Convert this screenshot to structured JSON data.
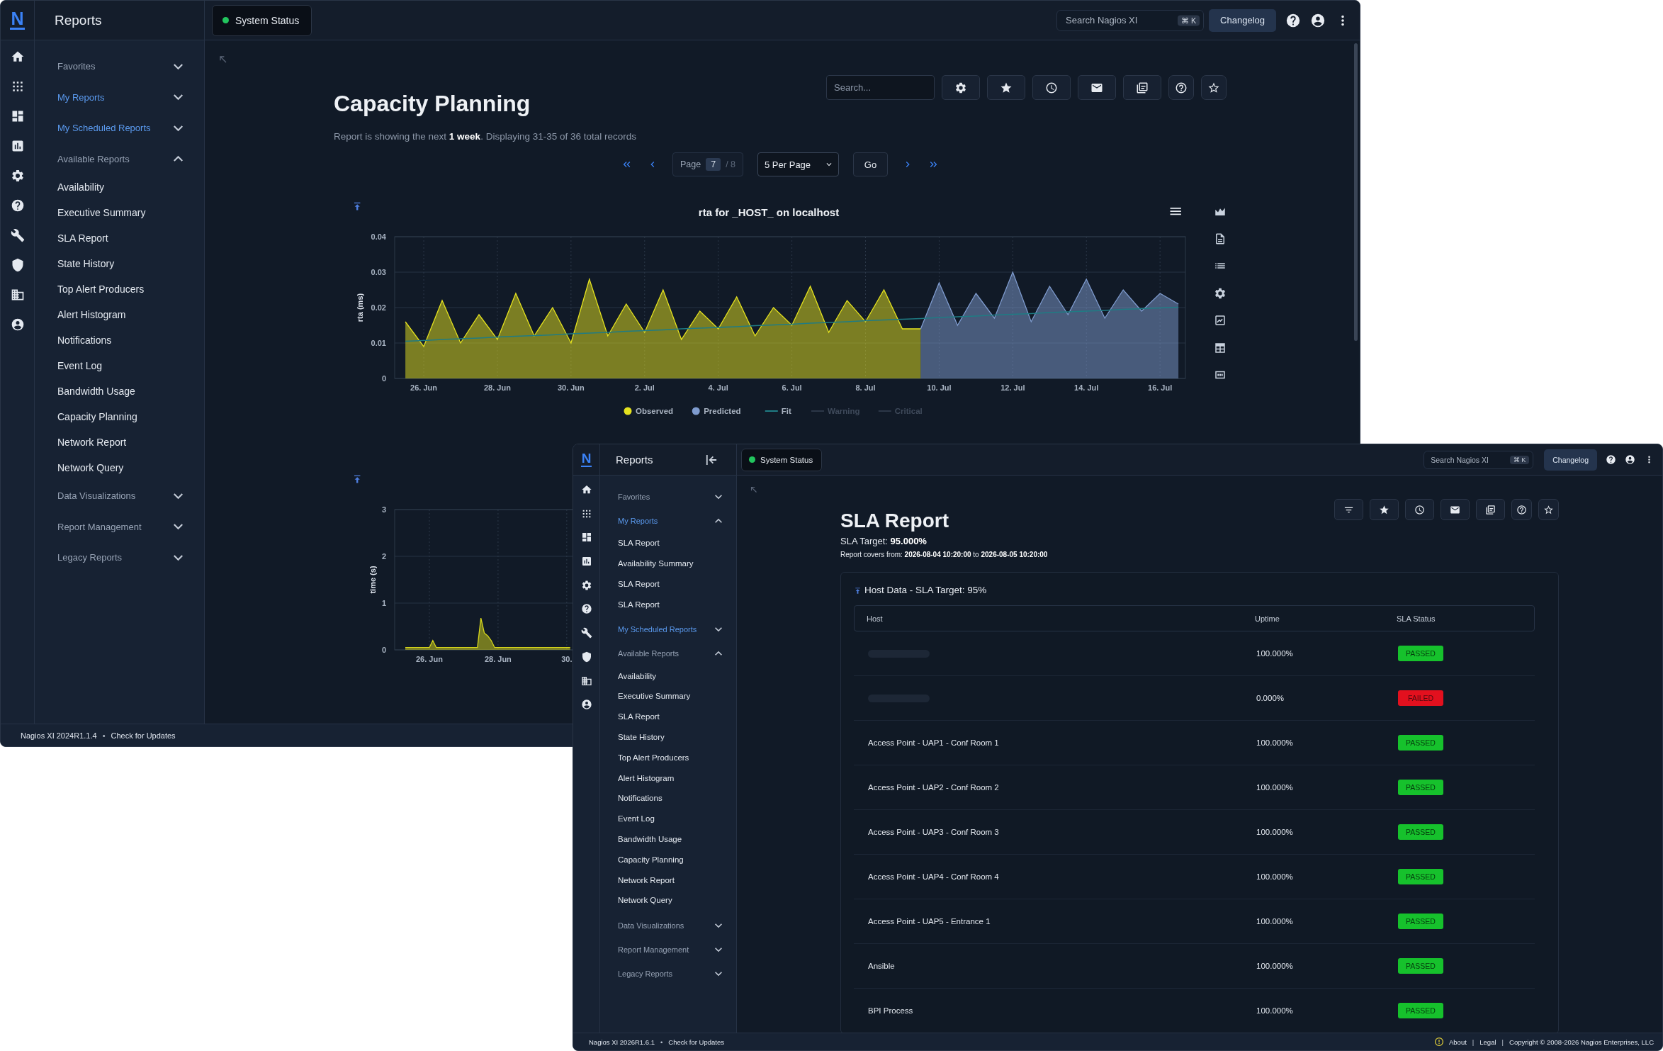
{
  "windows": [
    {
      "kind": "back",
      "header": {
        "logo": "N",
        "title": "Reports",
        "status": {
          "label": "System Status",
          "ok": true
        },
        "search": {
          "placeholder": "Search Nagios XI",
          "shortcut": "⌘ K"
        },
        "changelog": "Changelog"
      },
      "sidebar": {
        "groups": [
          {
            "label": "Favorites",
            "highlighted": false,
            "expanded": false
          },
          {
            "label": "My Reports",
            "highlighted": true,
            "expanded": false
          },
          {
            "label": "My Scheduled Reports",
            "highlighted": true,
            "expanded": false
          },
          {
            "label": "Available Reports",
            "highlighted": false,
            "expanded": true,
            "children": [
              {
                "label": "Availability"
              },
              {
                "label": "Executive Summary"
              },
              {
                "label": "SLA Report"
              },
              {
                "label": "State History"
              },
              {
                "label": "Top Alert Producers"
              },
              {
                "label": "Alert Histogram"
              },
              {
                "label": "Notifications"
              },
              {
                "label": "Event Log"
              },
              {
                "label": "Bandwidth Usage"
              },
              {
                "label": "Capacity Planning"
              },
              {
                "label": "Network Report"
              },
              {
                "label": "Network Query"
              }
            ]
          },
          {
            "label": "Data Visualizations",
            "highlighted": false,
            "expanded": false
          },
          {
            "label": "Report Management",
            "highlighted": false,
            "expanded": false
          },
          {
            "label": "Legacy Reports",
            "highlighted": false,
            "expanded": false
          }
        ]
      },
      "page": {
        "kind": "capacity_planning",
        "title": "Capacity Planning",
        "search": {
          "placeholder": "Search..."
        },
        "summary": "Report is showing the next **1 week**. Displaying 31-35 of 36 total records",
        "pagination": {
          "page_label": "Page",
          "page": "7",
          "page_count": "/ 8",
          "per_page": "5 Per Page",
          "go": "Go"
        },
        "charts": [
          {
            "chart_data": {
              "type": "area",
              "title": "rta for _HOST_ on localhost",
              "ylabel": "rta (ms)",
              "grid": true,
              "legend": "bottom",
              "categories": [
                null,
                "26. Jun",
                null,
                null,
                null,
                "28. Jun",
                null,
                null,
                null,
                "30. Jun",
                null,
                null,
                null,
                "2. Jul",
                null,
                null,
                null,
                "4. Jul",
                null,
                null,
                null,
                "6. Jul",
                null,
                null,
                null,
                "8. Jul",
                null,
                null,
                null,
                "10. Jul",
                null,
                null,
                null,
                "12. Jul",
                null,
                null,
                null,
                "14. Jul",
                null,
                null,
                null,
                "16. Jul",
                null
              ],
              "ylim": [
                0,
                0.04
              ],
              "yticks": [
                0,
                0.01,
                0.02,
                0.03,
                0.04
              ],
              "series": [
                {
                  "name": "Observed",
                  "color": "#e5e21f",
                  "values": [
                    0.016,
                    0.009,
                    0.022,
                    0.01,
                    0.018,
                    0.011,
                    0.024,
                    0.012,
                    0.02,
                    0.01,
                    0.028,
                    0.012,
                    0.021,
                    0.013,
                    0.025,
                    0.011,
                    0.019,
                    0.014,
                    0.023,
                    0.012,
                    0.02,
                    0.015,
                    0.026,
                    0.013,
                    0.022,
                    0.016,
                    0.025,
                    0.014,
                    0.014,
                    null,
                    null,
                    null,
                    null,
                    null,
                    null,
                    null,
                    null,
                    null,
                    null,
                    null,
                    null,
                    null,
                    null
                  ]
                },
                {
                  "name": "Predicted",
                  "color": "#7f9ccf",
                  "values": [
                    null,
                    null,
                    null,
                    null,
                    null,
                    null,
                    null,
                    null,
                    null,
                    null,
                    null,
                    null,
                    null,
                    null,
                    null,
                    null,
                    null,
                    null,
                    null,
                    null,
                    null,
                    null,
                    null,
                    null,
                    null,
                    null,
                    null,
                    null,
                    0.014,
                    0.027,
                    0.015,
                    0.024,
                    0.017,
                    0.03,
                    0.016,
                    0.026,
                    0.018,
                    0.028,
                    0.017,
                    0.025,
                    0.019,
                    0.024,
                    0.021
                  ]
                },
                {
                  "name": "Fit",
                  "color": "#1f7c84",
                  "type": "line",
                  "values": [
                    0.0105,
                    0.0107,
                    0.011,
                    0.0112,
                    0.0114,
                    0.0117,
                    0.0119,
                    0.0121,
                    0.0123,
                    0.0126,
                    0.0128,
                    0.013,
                    0.0133,
                    0.0135,
                    0.0137,
                    0.014,
                    0.0142,
                    0.0144,
                    0.0146,
                    0.0149,
                    0.0151,
                    0.0153,
                    0.0156,
                    0.0158,
                    0.016,
                    0.0163,
                    0.0165,
                    0.0167,
                    0.0169,
                    0.0172,
                    0.0174,
                    0.0176,
                    0.0179,
                    0.0181,
                    0.0183,
                    0.0186,
                    0.0188,
                    0.019,
                    0.0192,
                    0.0195,
                    0.0197,
                    0.0199,
                    0.0201
                  ]
                }
              ]
            },
            "hidden_legend_items": [
              {
                "label": "Warning"
              },
              {
                "label": "Critical"
              }
            ]
          },
          {
            "chart_data": {
              "type": "area",
              "ylabel": "time (s)",
              "grid": true,
              "categories": [
                null,
                null,
                null,
                null,
                null,
                null,
                null,
                "26. Jun",
                null,
                null,
                null,
                null,
                null,
                null,
                null,
                null,
                null,
                null,
                null,
                null,
                null,
                null,
                null,
                null,
                null,
                null,
                null,
                "28. Jun",
                null,
                null,
                null,
                null,
                null,
                null,
                null,
                null,
                null,
                null,
                null,
                null,
                null,
                null,
                null,
                null,
                null,
                null,
                null,
                "30.",
                null,
                null
              ],
              "ylim": [
                0,
                3
              ],
              "yticks": [
                0,
                1,
                2,
                3
              ],
              "series": [
                {
                  "color": "#d8d81c",
                  "values": [
                    0.05,
                    0.05,
                    0.05,
                    0.05,
                    0.05,
                    0.05,
                    0.05,
                    0.05,
                    0.2,
                    0.05,
                    0.05,
                    0.05,
                    0.05,
                    0.05,
                    0.05,
                    0.05,
                    0.05,
                    0.05,
                    0.05,
                    0.05,
                    0.05,
                    0.05,
                    0.68,
                    0.36,
                    0.3,
                    0.2,
                    0.05,
                    0.05,
                    0.05,
                    0.05,
                    0.05,
                    0.05,
                    0.05,
                    0.05,
                    0.05,
                    0.05,
                    0.05,
                    0.05,
                    0.05,
                    0.05,
                    0.05,
                    0.05,
                    0.05,
                    0.05,
                    0.05,
                    0.05,
                    0.05,
                    0.05,
                    0.05,
                    null
                  ]
                }
              ]
            }
          }
        ]
      },
      "footer": {
        "left": [
          {
            "kind": "text",
            "text": "Nagios XI 2024R1.1.4"
          },
          {
            "kind": "separator",
            "text": "•"
          },
          {
            "kind": "link",
            "text": "Check for Updates"
          }
        ]
      }
    },
    {
      "kind": "front",
      "header": {
        "logo": "N",
        "title": "Reports",
        "collapse_button": true,
        "status": {
          "label": "System Status",
          "ok": true
        },
        "search": {
          "placeholder": "Search Nagios XI",
          "shortcut": "⌘ K"
        },
        "changelog": "Changelog"
      },
      "sidebar": {
        "groups": [
          {
            "label": "Favorites",
            "highlighted": false,
            "expanded": false
          },
          {
            "label": "My Reports",
            "highlighted": true,
            "expanded": true,
            "children": [
              {
                "label": "SLA Report"
              },
              {
                "label": "Availability Summary"
              },
              {
                "label": "SLA Report"
              },
              {
                "label": "SLA Report"
              }
            ]
          },
          {
            "label": "My Scheduled Reports",
            "highlighted": true,
            "expanded": false
          },
          {
            "label": "Available Reports",
            "highlighted": false,
            "expanded": true,
            "children": [
              {
                "label": "Availability"
              },
              {
                "label": "Executive Summary"
              },
              {
                "label": "SLA Report"
              },
              {
                "label": "State History"
              },
              {
                "label": "Top Alert Producers"
              },
              {
                "label": "Alert Histogram"
              },
              {
                "label": "Notifications"
              },
              {
                "label": "Event Log"
              },
              {
                "label": "Bandwidth Usage"
              },
              {
                "label": "Capacity Planning"
              },
              {
                "label": "Network Report"
              },
              {
                "label": "Network Query"
              }
            ]
          },
          {
            "label": "Data Visualizations",
            "highlighted": false,
            "expanded": false
          },
          {
            "label": "Report Management",
            "highlighted": false,
            "expanded": false
          },
          {
            "label": "Legacy Reports",
            "highlighted": false,
            "expanded": false
          }
        ]
      },
      "page": {
        "kind": "sla_report",
        "title": "SLA Report",
        "target": "SLA Target: **95.000%**",
        "covers": "Report covers from: **2026-08-04 10:20:00** to **2026-08-05 10:20:00**",
        "table": {
          "title": "Host Data - SLA Target: 95%",
          "columns": [
            "Host",
            "Uptime",
            "SLA Status"
          ],
          "rows": [
            {
              "kind": "redacted",
              "uptime": "100.000%",
              "status": "PASSED",
              "passed": true
            },
            {
              "kind": "redacted",
              "uptime": "0.000%",
              "status": "FAILED",
              "passed": false
            },
            {
              "kind": "host",
              "host": "Access Point - UAP1 - Conf Room 1",
              "uptime": "100.000%",
              "status": "PASSED",
              "passed": true
            },
            {
              "kind": "host",
              "host": "Access Point - UAP2 - Conf Room 2",
              "uptime": "100.000%",
              "status": "PASSED",
              "passed": true
            },
            {
              "kind": "host",
              "host": "Access Point - UAP3 - Conf Room 3",
              "uptime": "100.000%",
              "status": "PASSED",
              "passed": true
            },
            {
              "kind": "host",
              "host": "Access Point - UAP4 - Conf Room 4",
              "uptime": "100.000%",
              "status": "PASSED",
              "passed": true
            },
            {
              "kind": "host",
              "host": "Access Point - UAP5 - Entrance 1",
              "uptime": "100.000%",
              "status": "PASSED",
              "passed": true
            },
            {
              "kind": "host",
              "host": "Ansible",
              "uptime": "100.000%",
              "status": "PASSED",
              "passed": true
            },
            {
              "kind": "host",
              "host": "BPI Process",
              "uptime": "100.000%",
              "status": "PASSED",
              "passed": true
            }
          ]
        }
      },
      "footer": {
        "notice": true,
        "left": [
          {
            "kind": "text",
            "text": "Nagios XI 2026R1.6.1"
          },
          {
            "kind": "separator",
            "text": "•"
          },
          {
            "kind": "link",
            "text": "Check for Updates"
          }
        ],
        "right": [
          {
            "kind": "link",
            "text": "About"
          },
          {
            "kind": "separator",
            "text": "|"
          },
          {
            "kind": "link",
            "text": "Legal"
          },
          {
            "kind": "separator",
            "text": "|"
          },
          {
            "kind": "text",
            "text": "Copyright © 2008-2026 Nagios Enterprises, LLC"
          }
        ]
      }
    }
  ]
}
